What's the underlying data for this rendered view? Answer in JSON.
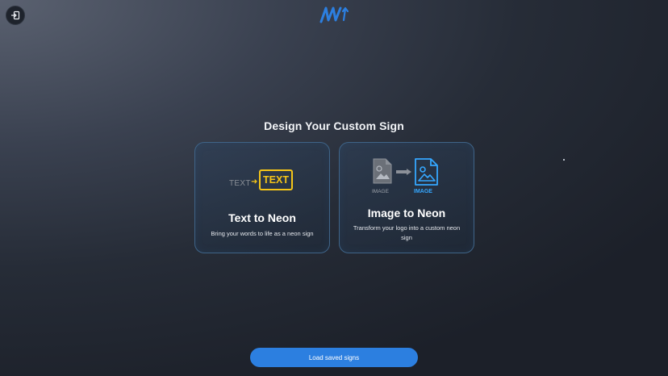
{
  "header": {
    "exit_icon": "exit-icon",
    "logo_icon": "brand-logo-icon"
  },
  "main": {
    "heading": "Design Your Custom Sign",
    "cards": [
      {
        "illustration_text_plain": "TEXT",
        "illustration_text_neon": "TEXT",
        "title": "Text to Neon",
        "description": "Bring your words to life as a neon sign"
      },
      {
        "illustration_label_from": "IMAGE",
        "illustration_label_to": "IMAGE",
        "title": "Image to Neon",
        "description": "Transform your logo into a custom neon sign"
      }
    ]
  },
  "footer": {
    "load_button": "Load saved signs"
  },
  "colors": {
    "accent_blue": "#2c7fe0",
    "neon_yellow": "#f5c518",
    "neon_blue": "#35a7ff",
    "card_border": "#3f6488"
  }
}
